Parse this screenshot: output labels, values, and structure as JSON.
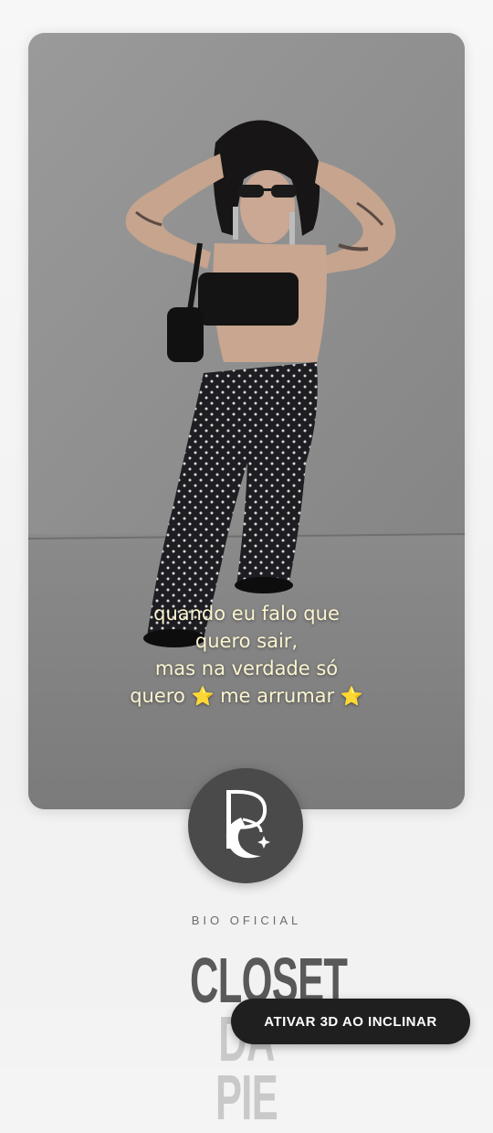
{
  "story": {
    "caption_line1": "quando eu falo que",
    "caption_line2": "quero sair,",
    "caption_line3": "mas na verdade só",
    "caption_line4_a": "quero",
    "caption_line4_b": "me arrumar",
    "star_emoji": "⭐"
  },
  "brand": {
    "logo_icon": "ps-moon-star-logo",
    "bio_label": "BIO OFICIAL",
    "title_line1": "CLOSET",
    "title_line2": "DA PIE"
  },
  "actions": {
    "tilt_3d_label": "ATIVAR 3D AO INCLINAR"
  },
  "colors": {
    "caption_text": "#fbf4cf",
    "button_bg": "#1f1f1f",
    "logo_bg": "#4a4a4a"
  }
}
